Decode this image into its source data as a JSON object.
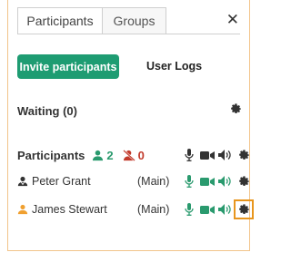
{
  "tabs": [
    {
      "label": "Participants",
      "active": true
    },
    {
      "label": "Groups",
      "active": false
    }
  ],
  "close_label": "✕",
  "toolbar": {
    "invite_label": "Invite participants",
    "userlogs_label": "User Logs"
  },
  "waiting": {
    "label": "Waiting (0)"
  },
  "participants_header": {
    "label": "Participants",
    "count_present": "2",
    "count_absent": "0"
  },
  "participants": [
    {
      "name": "Peter Grant",
      "role": "(Main)",
      "icon": "user-black-icon"
    },
    {
      "name": "James Stewart",
      "role": "(Main)",
      "icon": "user-orange-icon"
    }
  ],
  "colors": {
    "accent_green": "#1e9c72",
    "absent_red": "#c23a2b",
    "highlight_orange": "#e8961e"
  }
}
